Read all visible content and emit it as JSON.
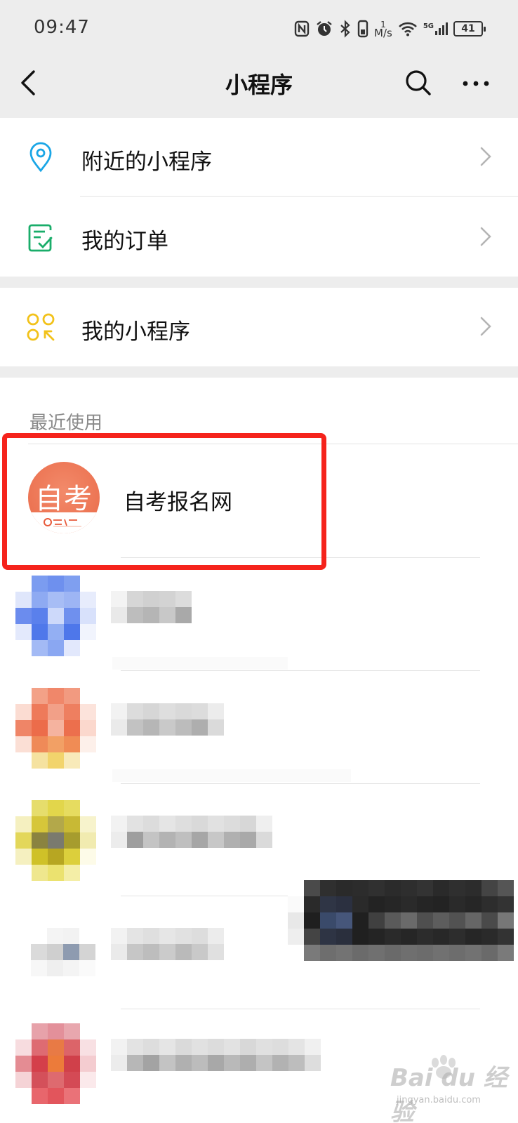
{
  "status_bar": {
    "time": "09:47",
    "net_speed_top": "1",
    "net_speed_unit": "M/s",
    "battery": "41",
    "signal_label": "5G"
  },
  "header": {
    "title": "小程序"
  },
  "menu": [
    {
      "label": "附近的小程序",
      "icon": "location-pin-icon"
    },
    {
      "label": "我的订单",
      "icon": "order-checklist-icon"
    },
    {
      "label": "我的小程序",
      "icon": "grid-apps-icon"
    }
  ],
  "recent": {
    "section_label": "最近使用",
    "items": [
      {
        "name": "自考报名网",
        "avatar_text": "自考",
        "highlighted": true
      }
    ]
  },
  "watermark": {
    "brand": "Bai du 经验",
    "url": "jingyan.baidu.com"
  },
  "colors": {
    "background": "#ededed",
    "highlight_border": "#f5231c",
    "avatar": "#ec7352",
    "location_icon": "#1aa6e6",
    "order_icon": "#1aad6a",
    "apps_icon": "#f2c21a"
  }
}
